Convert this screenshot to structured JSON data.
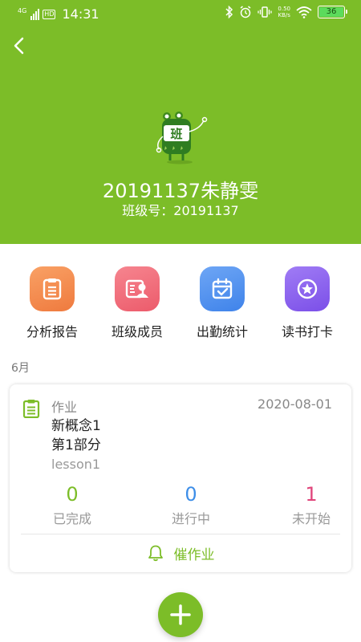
{
  "status_bar": {
    "network": "4G",
    "hd": "HD",
    "time": "14:31",
    "speed_value": "0.50",
    "speed_unit": "KB/s",
    "battery": "36"
  },
  "header": {
    "class_name": "20191137朱静雯",
    "class_number": "班级号：20191137",
    "mascot_text": "班"
  },
  "features": [
    {
      "label": "分析报告",
      "icon": "report-icon",
      "color": "#f4884a"
    },
    {
      "label": "班级成员",
      "icon": "members-icon",
      "color": "#f06a78"
    },
    {
      "label": "出勤统计",
      "icon": "calendar-icon",
      "color": "#4a8ef0"
    },
    {
      "label": "读书打卡",
      "icon": "star-badge-icon",
      "color": "#8b5ff0"
    }
  ],
  "month": "6月",
  "card": {
    "type_label": "作业",
    "date": "2020-08-01",
    "title_line1": "新概念1",
    "title_line2": "第1部分",
    "subtitle": "lesson1",
    "stats": [
      {
        "value": "0",
        "label": "已完成",
        "color": "#7cbd28"
      },
      {
        "value": "0",
        "label": "进行中",
        "color": "#3d8ee8"
      },
      {
        "value": "1",
        "label": "未开始",
        "color": "#e0447a"
      }
    ],
    "urge_label": "催作业"
  },
  "colors": {
    "brand_green": "#7cbd28"
  }
}
